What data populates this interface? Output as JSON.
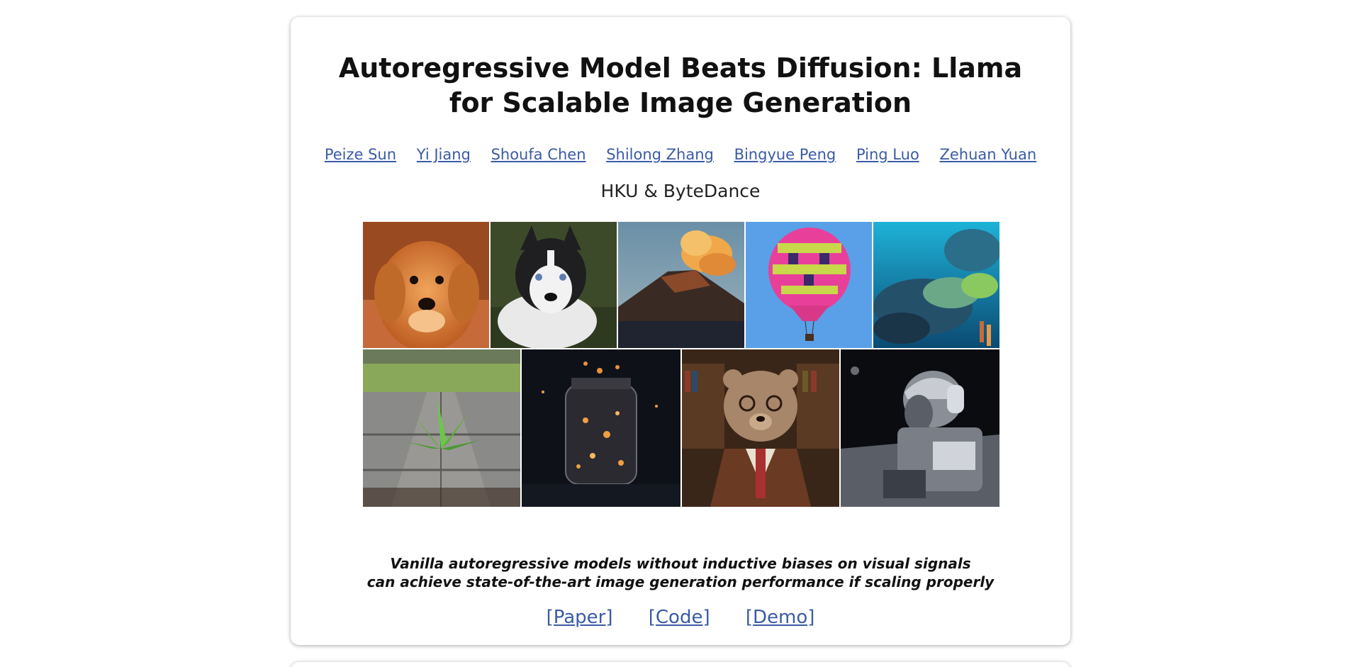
{
  "title": "Autoregressive Model Beats Diffusion: Llama for Scalable Image Generation",
  "authors": [
    "Peize Sun",
    "Yi Jiang",
    "Shoufa Chen",
    "Shilong Zhang",
    "Bingyue Peng",
    "Ping Luo",
    "Zehuan Yuan"
  ],
  "affiliation": "HKU & ByteDance",
  "gallery": {
    "row1": [
      "golden-retriever-puppy",
      "husky-puppy",
      "volcano",
      "hot-air-balloon",
      "coral-reef"
    ],
    "row2": [
      "plant-in-pavement",
      "glowing-jar",
      "bear-in-library",
      "astronaut-on-moon"
    ]
  },
  "tagline": {
    "line1": "Vanilla autoregressive models without inductive biases on visual signals",
    "line2": "can achieve state-of-the-art image generation performance if scaling properly"
  },
  "links": {
    "paper": "[Paper]",
    "code": "[Code]",
    "demo": "[Demo]"
  },
  "colors": {
    "link": "#3b5ba5",
    "text": "#111111",
    "background": "#ffffff"
  }
}
